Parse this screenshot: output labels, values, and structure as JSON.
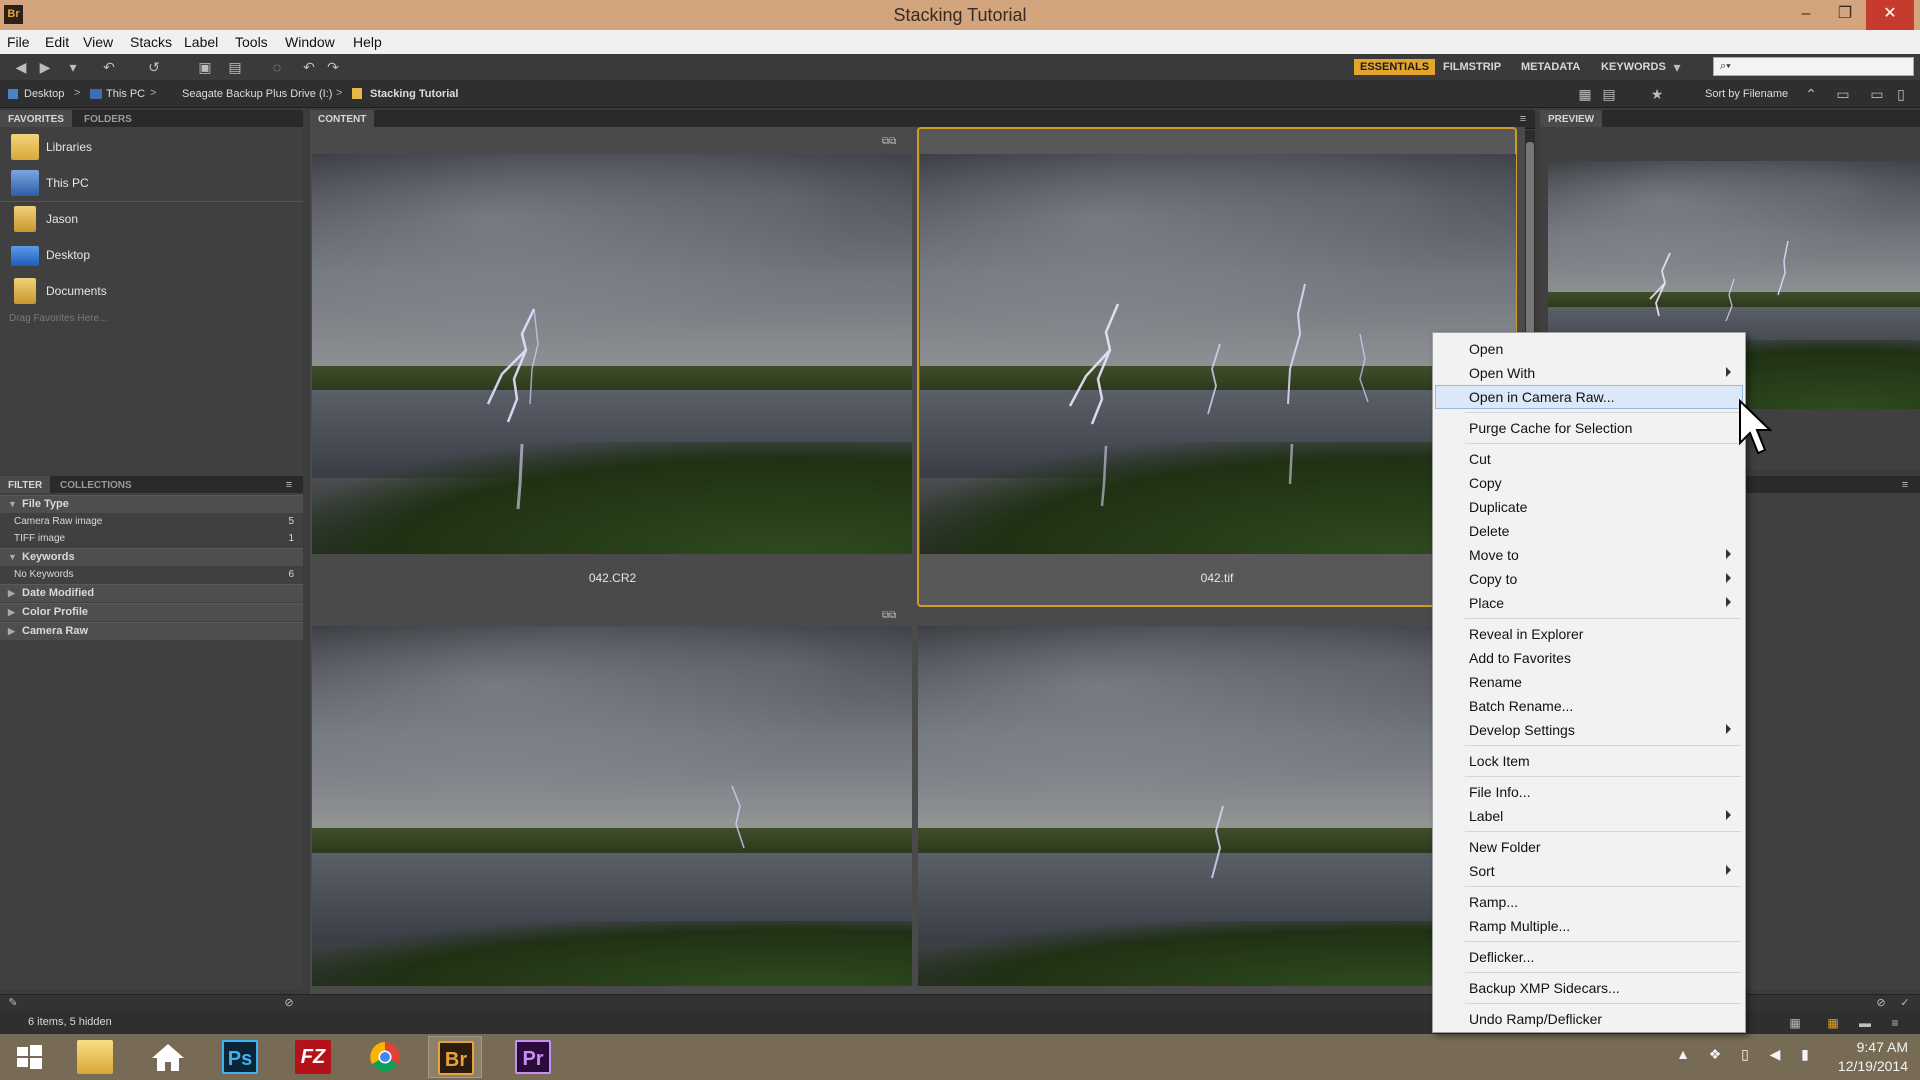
{
  "window": {
    "app_icon": "Br",
    "title": "Stacking Tutorial",
    "controls": {
      "minimize": "–",
      "restore": "❐",
      "close": "✕"
    }
  },
  "menu": [
    "File",
    "Edit",
    "View",
    "Stacks",
    "Label",
    "Tools",
    "Window",
    "Help"
  ],
  "toolbar": {
    "workspaces": [
      "ESSENTIALS",
      "FILMSTRIP",
      "METADATA",
      "KEYWORDS"
    ],
    "active_workspace": "ESSENTIALS",
    "search_placeholder": "⌕▾"
  },
  "path": {
    "crumbs": [
      "Desktop",
      "This PC",
      "Seagate Backup Plus Drive (I:)",
      "Stacking Tutorial"
    ],
    "sort_label": "Sort by Filename"
  },
  "panels": {
    "favorites_tab": "FAVORITES",
    "folders_tab": "FOLDERS",
    "content_tab": "CONTENT",
    "preview_tab": "PREVIEW",
    "filter_tab": "FILTER",
    "collections_tab": "COLLECTIONS"
  },
  "favorites": [
    {
      "label": "Libraries",
      "icon": "libraries-icon"
    },
    {
      "label": "This PC",
      "icon": "computer-icon"
    },
    {
      "label": "Jason",
      "icon": "user-folder-icon"
    },
    {
      "label": "Desktop",
      "icon": "desktop-icon"
    },
    {
      "label": "Documents",
      "icon": "documents-icon"
    }
  ],
  "favorites_hint": "Drag Favorites Here...",
  "filter": {
    "groups": [
      {
        "label": "File Type",
        "rows": [
          {
            "label": "Camera Raw image",
            "count": "5"
          },
          {
            "label": "TIFF image",
            "count": "1"
          }
        ]
      },
      {
        "label": "Keywords",
        "rows": [
          {
            "label": "No Keywords",
            "count": "6"
          }
        ]
      },
      {
        "label": "Date Modified",
        "rows": []
      },
      {
        "label": "Color Profile",
        "rows": []
      },
      {
        "label": "Camera Raw",
        "rows": []
      }
    ]
  },
  "content": {
    "thumbnails": [
      {
        "filename": "042.CR2",
        "selected": false
      },
      {
        "filename": "042.tif",
        "selected": true
      },
      {
        "filename": "",
        "selected": false
      },
      {
        "filename": "",
        "selected": false
      }
    ]
  },
  "status": "6 items, 5 hidden",
  "context_menu": [
    {
      "label": "Open",
      "submenu": false,
      "group": 1
    },
    {
      "label": "Open With",
      "submenu": true,
      "group": 1
    },
    {
      "label": "Open in Camera Raw...",
      "submenu": false,
      "group": 1,
      "highlight": true
    },
    {
      "label": "Purge Cache for Selection",
      "submenu": false,
      "group": 2
    },
    {
      "label": "Cut",
      "submenu": false,
      "group": 3
    },
    {
      "label": "Copy",
      "submenu": false,
      "group": 3
    },
    {
      "label": "Duplicate",
      "submenu": false,
      "group": 3
    },
    {
      "label": "Delete",
      "submenu": false,
      "group": 3
    },
    {
      "label": "Move to",
      "submenu": true,
      "group": 3
    },
    {
      "label": "Copy to",
      "submenu": true,
      "group": 3
    },
    {
      "label": "Place",
      "submenu": true,
      "group": 3
    },
    {
      "label": "Reveal in Explorer",
      "submenu": false,
      "group": 4
    },
    {
      "label": "Add to Favorites",
      "submenu": false,
      "group": 4
    },
    {
      "label": "Rename",
      "submenu": false,
      "group": 4
    },
    {
      "label": "Batch Rename...",
      "submenu": false,
      "group": 4
    },
    {
      "label": "Develop Settings",
      "submenu": true,
      "group": 4
    },
    {
      "label": "Lock Item",
      "submenu": false,
      "group": 5
    },
    {
      "label": "File Info...",
      "submenu": false,
      "group": 6
    },
    {
      "label": "Label",
      "submenu": true,
      "group": 6
    },
    {
      "label": "New Folder",
      "submenu": false,
      "group": 7
    },
    {
      "label": "Sort",
      "submenu": true,
      "group": 7
    },
    {
      "label": "Ramp...",
      "submenu": false,
      "group": 8
    },
    {
      "label": "Ramp Multiple...",
      "submenu": false,
      "group": 8
    },
    {
      "label": "Deflicker...",
      "submenu": false,
      "group": 9
    },
    {
      "label": "Backup XMP Sidecars...",
      "submenu": false,
      "group": 10
    },
    {
      "label": "Undo Ramp/Deflicker",
      "submenu": false,
      "group": 11
    }
  ],
  "taskbar": {
    "apps": [
      {
        "name": "windows-start",
        "glyph": ""
      },
      {
        "name": "file-explorer",
        "glyph": ""
      },
      {
        "name": "home",
        "glyph": ""
      },
      {
        "name": "photoshop",
        "glyph": "Ps"
      },
      {
        "name": "filezilla",
        "glyph": "FZ"
      },
      {
        "name": "chrome",
        "glyph": ""
      },
      {
        "name": "bridge",
        "glyph": "Br"
      },
      {
        "name": "premiere",
        "glyph": "Pr"
      }
    ],
    "time": "9:47 AM",
    "date": "12/19/2014"
  },
  "colors": {
    "accent": "#e3a52d",
    "titlebar": "#d3a57e",
    "taskbar": "#786b55",
    "selection_border": "#d19b2a",
    "menu_highlight": "#dbe8f7"
  }
}
